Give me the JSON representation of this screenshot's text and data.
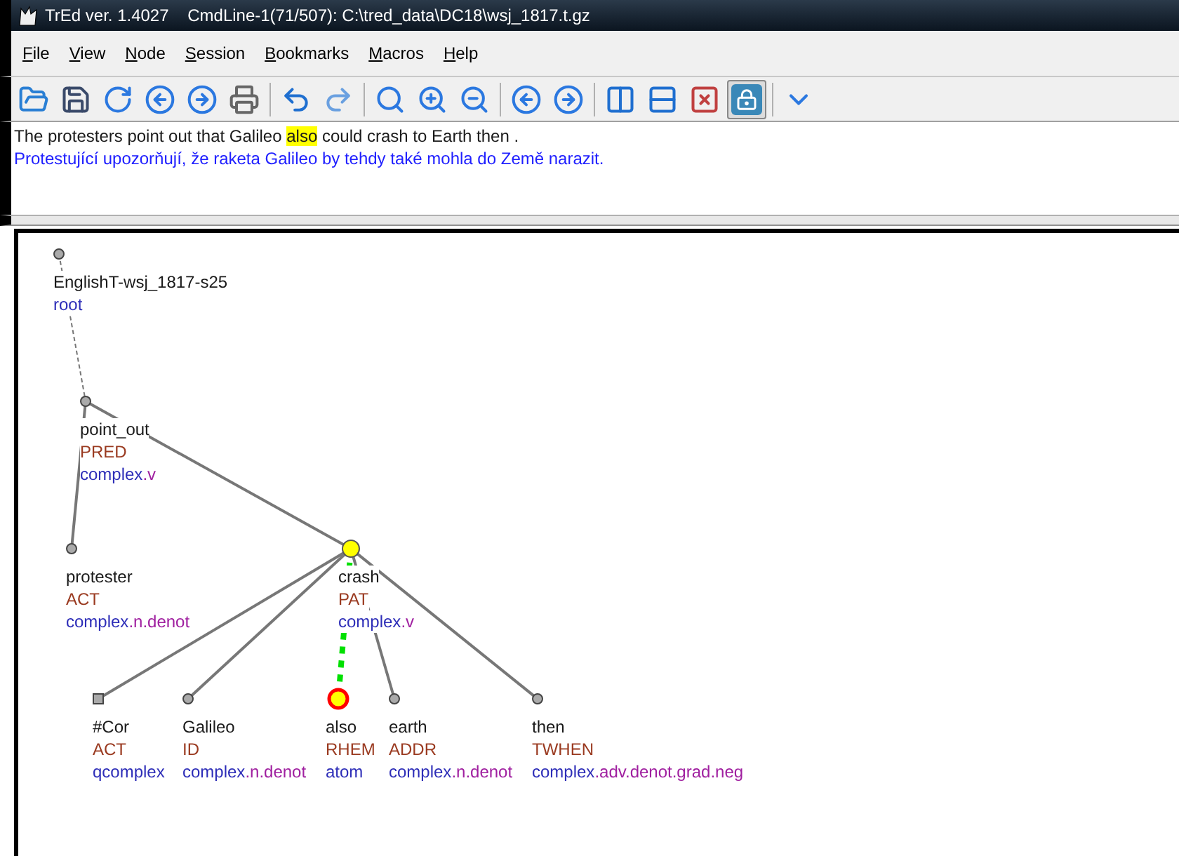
{
  "window": {
    "title": "TrEd ver. 1.4027    CmdLine-1(71/507): C:\\tred_data\\DC18\\wsj_1817.t.gz"
  },
  "menu": [
    "File",
    "View",
    "Node",
    "Session",
    "Bookmarks",
    "Macros",
    "Help"
  ],
  "toolbar": [
    {
      "selected": false
    },
    {
      "selected": false
    },
    {
      "selected": false
    },
    {
      "selected": false
    },
    {
      "selected": false
    },
    {
      "selected": false
    },
    {
      "selected": false
    },
    {
      "selected": false
    },
    {
      "selected": false
    },
    {
      "selected": false
    },
    {
      "selected": false
    },
    {
      "selected": false
    },
    {
      "selected": false
    },
    {
      "selected": false
    },
    {
      "selected": false
    },
    {
      "selected": false
    },
    {
      "selected": true
    },
    {
      "selected": false
    }
  ],
  "sentence": [
    {
      "text": "The protesters point out that Galileo",
      "highlighted": false
    },
    {
      "text": "also",
      "highlighted": true
    },
    {
      "text": "could crash to Earth then .",
      "highlighted": false
    }
  ],
  "translation": "Protestující upozorňují, že raketa Galileo by tehdy také mohla do Země narazit.",
  "tree": {
    "word": "EnglishT-wsj_1817-s25",
    "type": "root",
    "kind": "circle",
    "children": [
      {
        "word": "point_out",
        "functor": "PRED",
        "type": "complex.v",
        "kind": "circle",
        "children": [
          {
            "word": "protester",
            "functor": "ACT",
            "type": "complex.n.denot",
            "kind": "circle"
          },
          {
            "word": "crash",
            "functor": "PAT",
            "type": "complex.v",
            "kind": "highlight",
            "children": [
              {
                "word": "#Cor",
                "functor": "ACT",
                "type": "qcomplex",
                "kind": "square"
              },
              {
                "word": "Galileo",
                "functor": "ID",
                "type": "complex.n.denot",
                "kind": "circle"
              },
              {
                "word": "also",
                "functor": "RHEM",
                "type": "atom",
                "kind": "current"
              },
              {
                "word": "earth",
                "functor": "ADDR",
                "type": "complex.n.denot",
                "kind": "circle"
              },
              {
                "word": "then",
                "functor": "TWHEN",
                "type": "complex.adv.denot.grad.neg",
                "kind": "circle"
              }
            ]
          }
        ]
      }
    ]
  }
}
